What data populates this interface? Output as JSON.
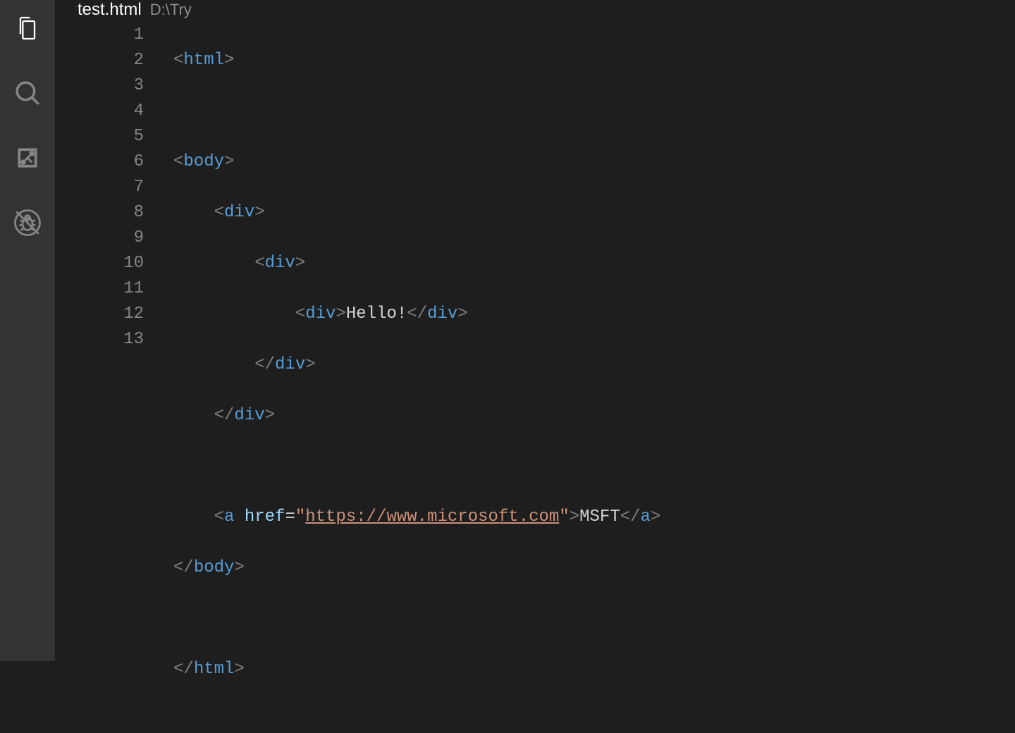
{
  "activity": {
    "items": [
      "explorer",
      "search",
      "scm",
      "debug"
    ]
  },
  "tab": {
    "filename": "test.html",
    "path": "D:\\Try"
  },
  "code": {
    "line_count": 13,
    "tokens": {
      "lt": "<",
      "gt": ">",
      "lts": "</",
      "html": "html",
      "body": "body",
      "div": "div",
      "a": "a",
      "hello": "Hello!",
      "href": "href",
      "eq": "=",
      "q": "\"",
      "url": "https://www.microsoft.com",
      "msft": "MSFT"
    }
  }
}
